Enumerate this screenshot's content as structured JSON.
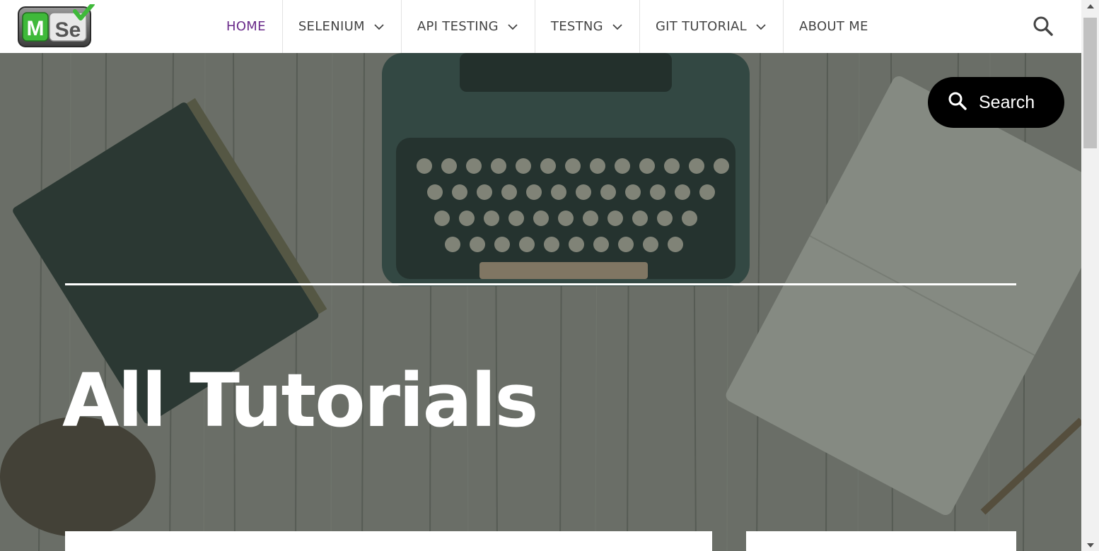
{
  "logo": {
    "letters_left": "M",
    "letters_right": "Se"
  },
  "nav": {
    "items": [
      {
        "label": "HOME",
        "has_dropdown": false,
        "active": true
      },
      {
        "label": "SELENIUM",
        "has_dropdown": true,
        "active": false
      },
      {
        "label": "API TESTING",
        "has_dropdown": true,
        "active": false
      },
      {
        "label": "TESTNG",
        "has_dropdown": true,
        "active": false
      },
      {
        "label": "GIT TUTORIAL",
        "has_dropdown": true,
        "active": false
      },
      {
        "label": "ABOUT ME",
        "has_dropdown": false,
        "active": false
      }
    ],
    "search_icon": "search-icon"
  },
  "hero": {
    "title": "All Tutorials",
    "search_button_label": "Search",
    "search_button_icon": "search-icon"
  },
  "colors": {
    "active_nav": "#6a2b8a",
    "nav_text": "#444444",
    "search_pill_bg": "#000000",
    "hero_title": "#ffffff"
  }
}
